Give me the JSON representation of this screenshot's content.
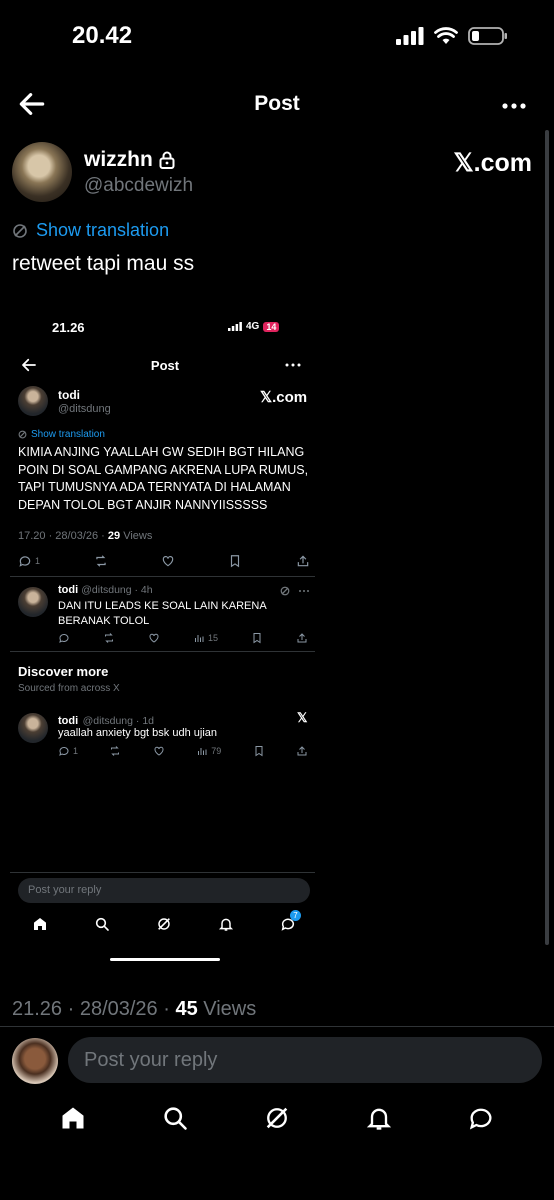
{
  "status_bar": {
    "time": "20.42"
  },
  "header": {
    "title": "Post"
  },
  "post": {
    "author_name": "wizzhn",
    "author_handle": "@abcdewizh",
    "source_label": "𝕏.com",
    "translation_link": "Show translation",
    "text": "retweet tapi mau ss",
    "timestamp": "21.26 · 28/03/26 · ",
    "views_count": "45",
    "views_label": " Views"
  },
  "embedded": {
    "status": {
      "time": "21.26",
      "network": "4G",
      "battery": "14"
    },
    "header_title": "Post",
    "post": {
      "author_name": "todi",
      "author_handle": "@ditsdung",
      "source_label": "𝕏.com",
      "translation_link": "Show translation",
      "text": "KIMIA ANJING YAALLAH GW SEDIH BGT HILANG POIN DI SOAL GAMPANG AKRENA LUPA RUMUS, TAPI TUMUSNYA ADA TERNYATA DI HALAMAN DEPAN TOLOL BGT ANJIR NANNYIISSSSS",
      "timestamp": "17.20 · 28/03/26 · ",
      "views_count": "29",
      "views_label": " Views",
      "reply_count": "1"
    },
    "reply": {
      "author": "todi",
      "handle_time": "@ditsdung · 4h",
      "text": "DAN ITU LEADS KE SOAL LAIN KARENA BERANAK TOLOL",
      "views": "15"
    },
    "discover": {
      "title": "Discover more",
      "subtitle": "Sourced from across X"
    },
    "discover_post": {
      "author": "todi",
      "handle_time": "@ditsdung · 1d",
      "text": "yaallah anxiety bgt bsk udh ujian",
      "reply_count": "1",
      "views": "79"
    },
    "reply_placeholder": "Post your reply",
    "notif_badge": "7"
  },
  "reply_placeholder": "Post your reply",
  "icons": [
    "back-arrow-icon",
    "more-icon",
    "lock-icon",
    "translate-icon",
    "reply-icon",
    "repost-icon",
    "like-icon",
    "bookmark-icon",
    "share-icon",
    "views-icon",
    "home-icon",
    "search-icon",
    "grok-icon",
    "bell-icon",
    "messages-icon"
  ],
  "colors": {
    "accent": "#1d9bf0",
    "muted": "#71767b",
    "background": "#000000"
  }
}
